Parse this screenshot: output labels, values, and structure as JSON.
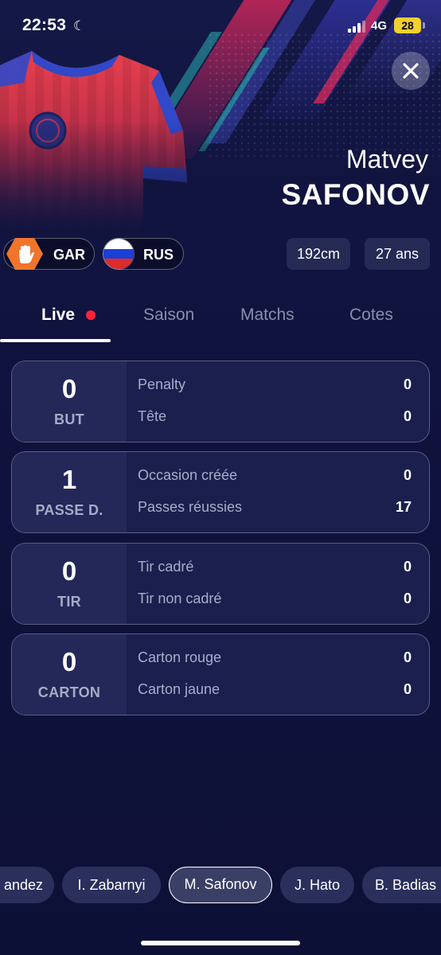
{
  "status_bar": {
    "time": "22:53",
    "network": "4G",
    "battery": "28"
  },
  "player": {
    "first_name": "Matvey",
    "last_name": "SAFONOV",
    "position_tag": "GAR",
    "nation_tag": "RUS",
    "height": "192cm",
    "age": "27 ans"
  },
  "tabs": [
    {
      "label": "Live"
    },
    {
      "label": "Saison"
    },
    {
      "label": "Matchs"
    },
    {
      "label": "Cotes"
    }
  ],
  "stats": [
    {
      "value": "0",
      "label": "BUT",
      "rows": [
        {
          "label": "Penalty",
          "value": "0"
        },
        {
          "label": "Tête",
          "value": "0"
        }
      ]
    },
    {
      "value": "1",
      "label": "PASSE D.",
      "rows": [
        {
          "label": "Occasion créée",
          "value": "0"
        },
        {
          "label": "Passes réussies",
          "value": "17"
        }
      ]
    },
    {
      "value": "0",
      "label": "TIR",
      "rows": [
        {
          "label": "Tir cadré",
          "value": "0"
        },
        {
          "label": "Tir non cadré",
          "value": "0"
        }
      ]
    },
    {
      "value": "0",
      "label": "CARTON",
      "rows": [
        {
          "label": "Carton rouge",
          "value": "0"
        },
        {
          "label": "Carton jaune",
          "value": "0"
        }
      ]
    }
  ],
  "player_chips": [
    {
      "label": "andez"
    },
    {
      "label": "I. Zabarnyi"
    },
    {
      "label": "M. Safonov",
      "active": true
    },
    {
      "label": "J. Hato"
    },
    {
      "label": "B. Badias"
    }
  ],
  "colors": {
    "background": "#0d1038",
    "card": "#1b1f4e",
    "live_dot": "#ff2238",
    "gk_badge": "#f0742c",
    "battery": "#f2d02f"
  },
  "icons": {
    "close": "close-icon",
    "goalkeeper": "goalkeeper-glove-icon",
    "flag": "russia-flag-icon",
    "moon": "moon-icon"
  }
}
